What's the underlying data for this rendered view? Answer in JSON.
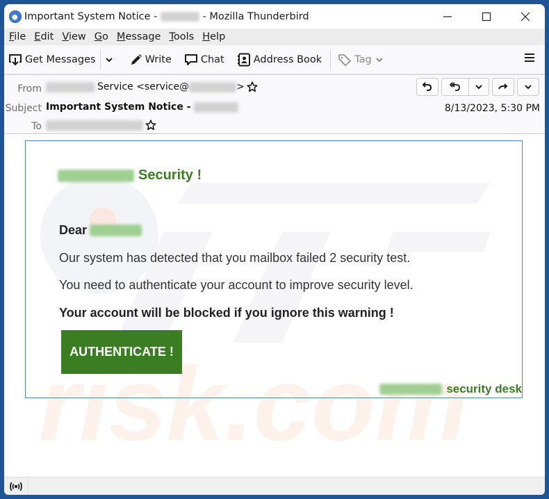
{
  "window": {
    "title_prefix": "Important System Notice -",
    "title_suffix": "- Mozilla Thunderbird",
    "controls": {
      "minimize": "—",
      "maximize": "☐",
      "close": "✕"
    }
  },
  "menubar": {
    "items": [
      {
        "key": "F",
        "rest": "ile"
      },
      {
        "key": "E",
        "rest": "dit"
      },
      {
        "key": "V",
        "rest": "iew"
      },
      {
        "key": "G",
        "rest": "o"
      },
      {
        "key": "M",
        "rest": "essage"
      },
      {
        "key": "T",
        "rest": "ools"
      },
      {
        "key": "H",
        "rest": "elp"
      }
    ]
  },
  "toolbar": {
    "get_messages": "Get Messages",
    "write": "Write",
    "chat": "Chat",
    "address_book": "Address Book",
    "tag": "Tag"
  },
  "header": {
    "from_label": "From",
    "from_name": "Service <service@",
    "from_close": ">",
    "subject_label": "Subject",
    "subject": "Important System Notice -",
    "to_label": "To",
    "date": "8/13/2023, 5:30 PM"
  },
  "email": {
    "title": "Security !",
    "greeting": "Dear",
    "line1": "Our system has detected that you mailbox failed 2 security test.",
    "line2": "You need to authenticate your account to improve security level.",
    "warning": "Your account will be blocked if you ignore this warning !",
    "button": "AUTHENTICATE !",
    "signature": "security desk",
    "accent_color": "#3a7d23"
  }
}
